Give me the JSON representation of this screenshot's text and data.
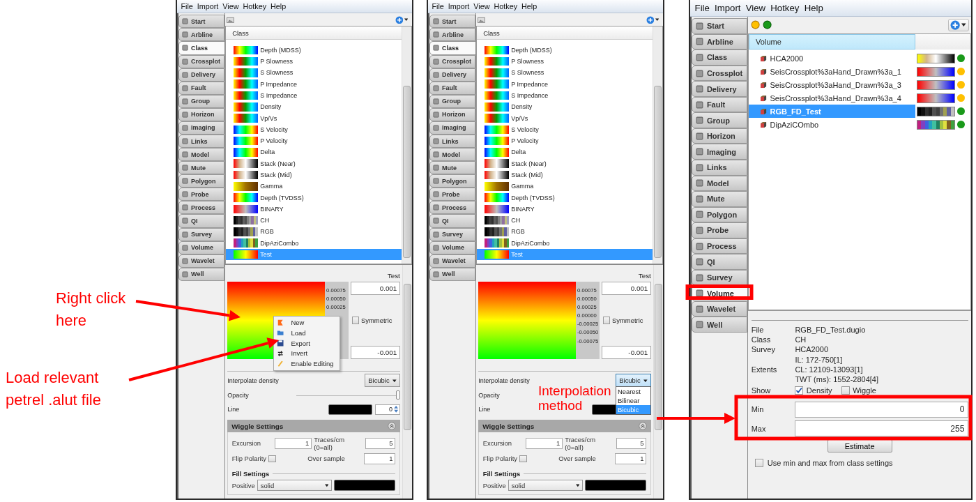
{
  "screens": [
    {
      "kind": "class",
      "menu": [
        "File",
        "Import",
        "View",
        "Hotkey",
        "Help"
      ],
      "tabs": [
        {
          "label": "Start",
          "selected": false
        },
        {
          "label": "Arbline",
          "selected": false
        },
        {
          "label": "Class",
          "selected": true
        },
        {
          "label": "Crossplot",
          "selected": false
        },
        {
          "label": "Delivery",
          "selected": false
        },
        {
          "label": "Fault",
          "selected": false
        },
        {
          "label": "Group",
          "selected": false
        },
        {
          "label": "Horizon",
          "selected": false
        },
        {
          "label": "Imaging",
          "selected": false
        },
        {
          "label": "Links",
          "selected": false
        },
        {
          "label": "Model",
          "selected": false
        },
        {
          "label": "Mute",
          "selected": false
        },
        {
          "label": "Polygon",
          "selected": false
        },
        {
          "label": "Probe",
          "selected": false
        },
        {
          "label": "Process",
          "selected": false
        },
        {
          "label": "QI",
          "selected": false
        },
        {
          "label": "Survey",
          "selected": false
        },
        {
          "label": "Volume",
          "selected": false
        },
        {
          "label": "Wavelet",
          "selected": false
        },
        {
          "label": "Well",
          "selected": false
        }
      ],
      "list": {
        "header": "Class",
        "rows": [
          {
            "label": "Depth (MDSS)",
            "kind": "spectrum",
            "selected": false
          },
          {
            "label": "P Slowness",
            "kind": "impedance",
            "selected": false
          },
          {
            "label": "S Slowness",
            "kind": "impedance",
            "selected": false
          },
          {
            "label": "P Impedance",
            "kind": "impedance",
            "selected": false
          },
          {
            "label": "S Impedance",
            "kind": "impedance",
            "selected": false
          },
          {
            "label": "Density",
            "kind": "impedance",
            "selected": false
          },
          {
            "label": "Vp/Vs",
            "kind": "impedance",
            "selected": false
          },
          {
            "label": "S Velocity",
            "kind": "velocity",
            "selected": false
          },
          {
            "label": "P Velocity",
            "kind": "velocity",
            "selected": false
          },
          {
            "label": "Delta",
            "kind": "velocity",
            "selected": false
          },
          {
            "label": "Stack (Near)",
            "kind": "stack",
            "selected": false
          },
          {
            "label": "Stack (Mid)",
            "kind": "stack",
            "selected": false
          },
          {
            "label": "Gamma",
            "kind": "gamma",
            "selected": false
          },
          {
            "label": "Depth (TVDSS)",
            "kind": "spectrum",
            "selected": false
          },
          {
            "label": "BINARY",
            "kind": "binary",
            "selected": false
          },
          {
            "label": "CH",
            "kind": "greystripes",
            "selected": false
          },
          {
            "label": "RGB",
            "kind": "darkstripes",
            "selected": false
          },
          {
            "label": "DipAziCombo",
            "kind": "colorstripes",
            "selected": false
          },
          {
            "label": "Test",
            "kind": "greenred",
            "selected": true
          }
        ]
      },
      "detail": {
        "title": "Test",
        "ticks": [
          "0.00075",
          "0.00050",
          "0.00025"
        ],
        "max": "0.001",
        "min": "-0.001",
        "symmetric": {
          "label": "Symmetric",
          "checked": false
        },
        "context_menu": [
          "New",
          "Load",
          "Export",
          "Invert",
          "Enable Editing"
        ],
        "interpolate": {
          "label": "Interpolate density",
          "value": "Bicubic",
          "expanded": false
        },
        "opacity": {
          "label": "Opacity",
          "level": 1
        },
        "line": {
          "label": "Line",
          "color": "#000000",
          "value": "0"
        },
        "wiggle": {
          "title": "Wiggle Settings",
          "excursion_label": "Excursion",
          "excursion": "1",
          "traces_label": "Traces/cm (0=all)",
          "traces": "5",
          "flip_label": "Flip Polarity",
          "flip": false,
          "oversample_label": "Over sample",
          "oversample": "1"
        },
        "fill": {
          "title": "Fill Settings",
          "positive_label": "Positive",
          "positive": "solid"
        }
      }
    },
    {
      "kind": "class",
      "menu": [
        "File",
        "Import",
        "View",
        "Hotkey",
        "Help"
      ],
      "tabs": [
        {
          "label": "Start",
          "selected": false
        },
        {
          "label": "Arbline",
          "selected": false
        },
        {
          "label": "Class",
          "selected": true
        },
        {
          "label": "Crossplot",
          "selected": false
        },
        {
          "label": "Delivery",
          "selected": false
        },
        {
          "label": "Fault",
          "selected": false
        },
        {
          "label": "Group",
          "selected": false
        },
        {
          "label": "Horizon",
          "selected": false
        },
        {
          "label": "Imaging",
          "selected": false
        },
        {
          "label": "Links",
          "selected": false
        },
        {
          "label": "Model",
          "selected": false
        },
        {
          "label": "Mute",
          "selected": false
        },
        {
          "label": "Polygon",
          "selected": false
        },
        {
          "label": "Probe",
          "selected": false
        },
        {
          "label": "Process",
          "selected": false
        },
        {
          "label": "QI",
          "selected": false
        },
        {
          "label": "Survey",
          "selected": false
        },
        {
          "label": "Volume",
          "selected": false
        },
        {
          "label": "Wavelet",
          "selected": false
        },
        {
          "label": "Well",
          "selected": false
        }
      ],
      "list": {
        "header": "Class",
        "rows": [
          {
            "label": "Depth (MDSS)",
            "kind": "spectrum",
            "selected": false
          },
          {
            "label": "P Slowness",
            "kind": "impedance",
            "selected": false
          },
          {
            "label": "S Slowness",
            "kind": "impedance",
            "selected": false
          },
          {
            "label": "P Impedance",
            "kind": "impedance",
            "selected": false
          },
          {
            "label": "S Impedance",
            "kind": "impedance",
            "selected": false
          },
          {
            "label": "Density",
            "kind": "impedance",
            "selected": false
          },
          {
            "label": "Vp/Vs",
            "kind": "impedance",
            "selected": false
          },
          {
            "label": "S Velocity",
            "kind": "velocity",
            "selected": false
          },
          {
            "label": "P Velocity",
            "kind": "velocity",
            "selected": false
          },
          {
            "label": "Delta",
            "kind": "velocity",
            "selected": false
          },
          {
            "label": "Stack (Near)",
            "kind": "stack",
            "selected": false
          },
          {
            "label": "Stack (Mid)",
            "kind": "stack",
            "selected": false
          },
          {
            "label": "Gamma",
            "kind": "gamma",
            "selected": false
          },
          {
            "label": "Depth (TVDSS)",
            "kind": "spectrum",
            "selected": false
          },
          {
            "label": "BINARY",
            "kind": "binary",
            "selected": false
          },
          {
            "label": "CH",
            "kind": "greystripes",
            "selected": false
          },
          {
            "label": "RGB",
            "kind": "darkstripes",
            "selected": false
          },
          {
            "label": "DipAziCombo",
            "kind": "colorstripes",
            "selected": false
          },
          {
            "label": "Test",
            "kind": "greenred",
            "selected": true
          }
        ]
      },
      "detail": {
        "title": "Test",
        "ticks": [
          "0.00075",
          "0.00050",
          "0.00025",
          "0.00000",
          "-0.00025",
          "-0.00050",
          "-0.00075"
        ],
        "max": "0.001",
        "min": "-0.001",
        "symmetric": {
          "label": "Symmetric",
          "checked": false
        },
        "interpolate": {
          "label": "Interpolate density",
          "value": "Bicubic",
          "expanded": true,
          "options": [
            {
              "label": "Nearest",
              "selected": false
            },
            {
              "label": "Bilinear",
              "selected": false
            },
            {
              "label": "Bicubic",
              "selected": true
            }
          ]
        },
        "opacity": {
          "label": "Opacity"
        },
        "line": {
          "label": "Line",
          "color": "#000000"
        },
        "wiggle": {
          "title": "Wiggle Settings",
          "excursion_label": "Excursion",
          "excursion": "1",
          "traces_label": "Traces/cm (0=all)",
          "traces": "5",
          "flip_label": "Flip Polarity",
          "flip": false,
          "oversample_label": "Over sample",
          "oversample": "1"
        },
        "fill": {
          "title": "Fill Settings",
          "positive_label": "Positive",
          "positive": "solid"
        }
      }
    },
    {
      "kind": "volume",
      "menu": [
        "File",
        "Import",
        "View",
        "Hotkey",
        "Help"
      ],
      "tabs": [
        {
          "label": "Start",
          "selected": false
        },
        {
          "label": "Arbline",
          "selected": false
        },
        {
          "label": "Class",
          "selected": false
        },
        {
          "label": "Crossplot",
          "selected": false
        },
        {
          "label": "Delivery",
          "selected": false
        },
        {
          "label": "Fault",
          "selected": false
        },
        {
          "label": "Group",
          "selected": false
        },
        {
          "label": "Horizon",
          "selected": false
        },
        {
          "label": "Imaging",
          "selected": false
        },
        {
          "label": "Links",
          "selected": false
        },
        {
          "label": "Model",
          "selected": false
        },
        {
          "label": "Mute",
          "selected": false
        },
        {
          "label": "Polygon",
          "selected": false
        },
        {
          "label": "Probe",
          "selected": false
        },
        {
          "label": "Process",
          "selected": false
        },
        {
          "label": "QI",
          "selected": false
        },
        {
          "label": "Survey",
          "selected": false
        },
        {
          "label": "Volume",
          "selected": true
        },
        {
          "label": "Wavelet",
          "selected": false
        },
        {
          "label": "Well",
          "selected": false
        }
      ],
      "list": {
        "header": "Volume",
        "rows": [
          {
            "label": "HCA2000",
            "kind": "yellowstack",
            "color": "#1a9a1a",
            "selected": false
          },
          {
            "label": "SeisCrossplot%3aHand_Drawn%3a_1",
            "kind": "binary",
            "color": "#ffc000",
            "selected": false
          },
          {
            "label": "SeisCrossplot%3aHand_Drawn%3a_3",
            "kind": "binary",
            "color": "#ffc000",
            "selected": false
          },
          {
            "label": "SeisCrossplot%3aHand_Drawn%3a_4",
            "kind": "binary",
            "color": "#ffc000",
            "selected": false
          },
          {
            "label": "RGB_FD_Test",
            "kind": "darkstripes",
            "color": "#1a9a1a",
            "selected": true
          },
          {
            "label": "DipAziCOmbo",
            "kind": "colorstripes",
            "color": "#1a9a1a",
            "selected": false
          }
        ]
      },
      "detail": {
        "info": [
          {
            "label": "File",
            "values": [
              "RGB_FD_Test.dugio"
            ]
          },
          {
            "label": "Class",
            "values": [
              "CH"
            ]
          },
          {
            "label": "Survey",
            "values": [
              "HCA2000"
            ]
          },
          {
            "label": "Extents",
            "values": [
              "IL: 172-750[1]",
              "CL: 12109-13093[1]",
              "TWT (ms): 1552-2804[4]"
            ]
          }
        ],
        "show": {
          "label": "Show",
          "options": [
            {
              "label": "Density",
              "checked": true
            },
            {
              "label": "Wiggle",
              "checked": false
            }
          ]
        },
        "min": {
          "label": "Min",
          "value": "0"
        },
        "max": {
          "label": "Max",
          "value": "255"
        },
        "estimate": "Estimate",
        "use_class": {
          "label": "Use min and max from class settings",
          "checked": false
        }
      }
    }
  ],
  "annotations": [
    {
      "kind": "callout",
      "text": "Right click here"
    },
    {
      "kind": "callout",
      "text": "Load relevant petrel .alut file"
    },
    {
      "kind": "callout",
      "text": "Interpolation method"
    }
  ]
}
